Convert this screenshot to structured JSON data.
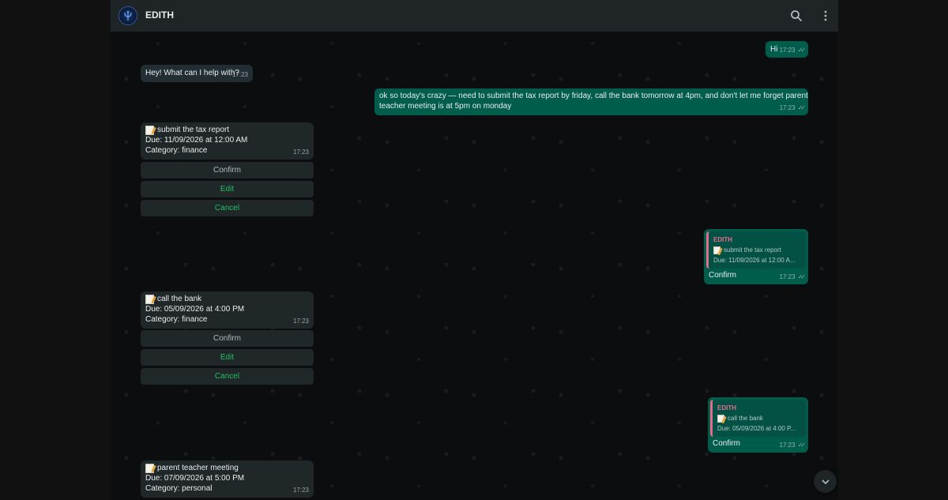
{
  "header": {
    "title": "EDITH"
  },
  "messages": {
    "hi": {
      "text": "Hi",
      "time": "17:23"
    },
    "greeting": {
      "text": "Hey! What can I help with?",
      "time": "17:23"
    },
    "request": {
      "line1": "ok so today's crazy — need to submit the tax report by friday, call the bank tomorrow at 4pm, and don't let me forget parent",
      "line2": "teacher meeting is at 5pm on monday",
      "time": "17:23"
    },
    "task1": {
      "title": "submit the tax report",
      "due": "Due: 11/09/2026 at 12:00 AM",
      "category": "Category: finance",
      "time": "17:23",
      "confirm": "Confirm",
      "edit": "Edit",
      "cancel": "Cancel"
    },
    "reply1": {
      "quote_name": "EDITH",
      "quote_title": "submit the tax report",
      "quote_due": "Due: 11/09/2026 at 12:00 A...",
      "text": "Confirm",
      "time": "17:23"
    },
    "task2": {
      "title": "call the bank",
      "due": "Due: 05/09/2026 at 4:00 PM",
      "category": "Category: finance",
      "time": "17:23",
      "confirm": "Confirm",
      "edit": "Edit",
      "cancel": "Cancel"
    },
    "reply2": {
      "quote_name": "EDITH",
      "quote_title": "call the bank",
      "quote_due": "Due: 05/09/2026 at 4:00 P...",
      "text": "Confirm",
      "time": "17:23"
    },
    "task3": {
      "title": "parent teacher meeting",
      "due": "Due: 07/09/2026 at 5:00 PM",
      "category": "Category: personal",
      "time": "17:23"
    }
  },
  "icons": {
    "search": "search-icon",
    "menu": "kebab-menu-icon",
    "scroll": "chevron-down-icon",
    "memo": "memo-icon",
    "ticks": "double-check-icon"
  },
  "colors": {
    "outgoing_bubble": "#005c4b",
    "incoming_bubble": "#222d34",
    "accent_green": "#21c063",
    "quote_name": "#e26d8a"
  }
}
